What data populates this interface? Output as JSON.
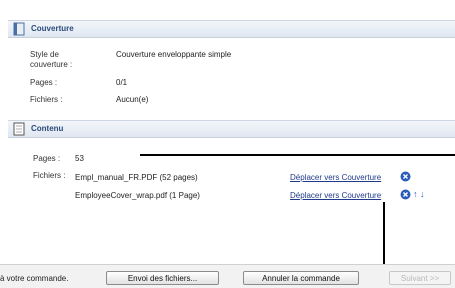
{
  "cover_section": {
    "title": "Couverture",
    "style_label": "Style de couverture :",
    "style_value": "Couverture enveloppante simple",
    "pages_label": "Pages :",
    "pages_value": "0/1",
    "files_label": "Fichiers :",
    "files_value": "Aucun(e)"
  },
  "content_section": {
    "title": "Contenu",
    "pages_label": "Pages :",
    "pages_value": "53",
    "files_label": "Fichiers :",
    "files": [
      {
        "name": "Empl_manual_FR.PDF (52 pages)",
        "action": "Déplacer vers Couverture"
      },
      {
        "name": "EmployeeCover_wrap.pdf (1 Page)",
        "action": "Déplacer vers Couverture"
      }
    ]
  },
  "footer": {
    "text": "à votre commande.",
    "send_button": "Envoi des fichiers...",
    "cancel_button": "Annuler la commande",
    "next_button": "Suivant >>"
  },
  "colors": {
    "accent": "#2c4a7a",
    "link": "#1f3a8a",
    "icon_blue": "#2b5cb8"
  }
}
